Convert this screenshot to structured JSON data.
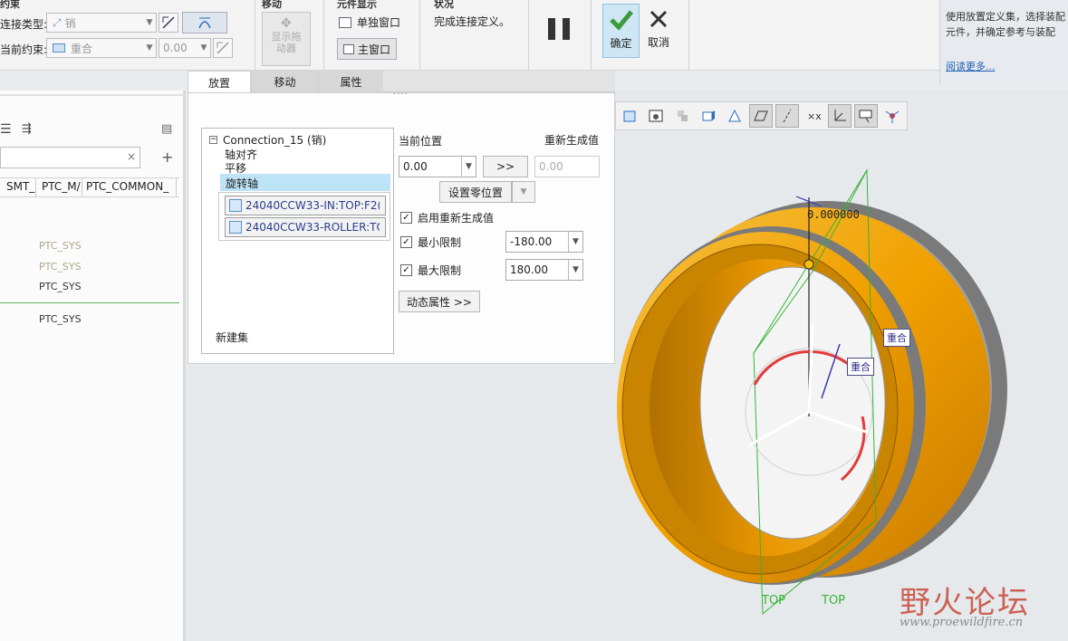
{
  "ribbon": {
    "constraint_group_title": "约束",
    "connection_type_label": "连接类型:",
    "connection_type_value": "销",
    "current_constraint_label": "当前约束:",
    "current_constraint_value": "重合",
    "offset_value": "0.00",
    "move_group_title": "移动",
    "show_dragger_label": "显示拖动器",
    "component_display_title": "元件显示",
    "separate_window_label": "单独窗口",
    "main_window_label": "主窗口",
    "status_title": "状况",
    "status_text": "完成连接定义。",
    "ok_label": "确定",
    "cancel_label": "取消"
  },
  "tabs": [
    {
      "label": "放置",
      "active": true
    },
    {
      "label": "移动",
      "active": false
    },
    {
      "label": "属性",
      "active": false
    }
  ],
  "help": {
    "text": "使用放置定义集，选择装配元件，并确定参考与装配",
    "link": "阅读更多..."
  },
  "left_panel": {
    "search_clear": "×",
    "add": "+",
    "columns": [
      "SMT_",
      "PTC_M/",
      "PTC_COMMON_"
    ],
    "rows": [
      "PTC_SYS",
      "PTC_SYS",
      "PTC_SYS",
      "PTC_SYS"
    ]
  },
  "placement": {
    "connection_name": "Connection_15 (销)",
    "constraints": [
      "轴对齐",
      "平移",
      "旋转轴"
    ],
    "selected_constraint": "旋转轴",
    "references": [
      "24040CCW33-IN:TOP:F2(",
      "24040CCW33-ROLLER:TO"
    ],
    "new_set": "新建集",
    "current_position_label": "当前位置",
    "current_position_value": "0.00",
    "transfer_button": ">>",
    "regen_value_label": "重新生成值",
    "regen_value": "0.00",
    "set_zero_button": "设置零位置",
    "enable_regen_label": "启用重新生成值",
    "min_limit_label": "最小限制",
    "min_limit_value": "-180.00",
    "max_limit_label": "最大限制",
    "max_limit_value": "180.00",
    "dynamic_props_button": "动态属性 >>"
  },
  "viewport": {
    "angle_readout": "0.000000",
    "constraint_tag_1": "重合",
    "constraint_tag_2": "重合",
    "plane_label_1": "TOP",
    "plane_label_2": "TOP",
    "watermark_main": "野火论坛",
    "watermark_url": "www.proewildfire.cn"
  },
  "colors": {
    "part_orange": "#f0a000",
    "part_gray": "#8f8f8f",
    "selection_blue": "#bde3f7",
    "datum_green": "#36b336",
    "ok_green": "#3b9b3b"
  }
}
